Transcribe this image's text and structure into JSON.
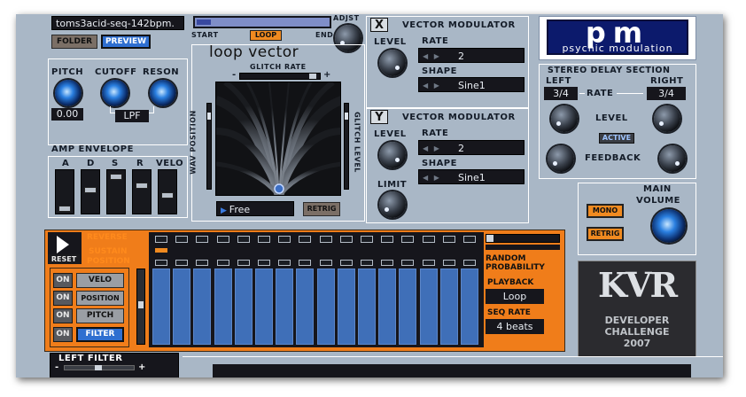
{
  "preset": {
    "name": "toms3acid-seq-142bpm.",
    "folder_label": "FOLDER",
    "preview_label": "PREVIEW"
  },
  "loop": {
    "start_label": "START",
    "loop_label": "LOOP",
    "end_label": "END",
    "adjust_label": "ADJST"
  },
  "filter": {
    "pitch_label": "PITCH",
    "cutoff_label": "CUTOFF",
    "reson_label": "RESON",
    "pitch_value": "0.00",
    "type_value": "LPF"
  },
  "amp_env": {
    "title": "AMP ENVELOPE",
    "labels": [
      "A",
      "D",
      "S",
      "R",
      "VELO"
    ]
  },
  "loop_vector": {
    "title": "loop vector",
    "glitch_rate_label": "GLITCH RATE",
    "minus": "-",
    "plus": "+",
    "wav_position_label": "WAV POSITION",
    "glitch_level_label": "GLITCH LEVEL",
    "mode_value": "Free",
    "retrig_label": "RETRIG"
  },
  "vector_mod_1": {
    "number": "X",
    "title": "VECTOR MODULATOR",
    "level_label": "LEVEL",
    "rate_label": "RATE",
    "rate_value": "2",
    "shape_label": "SHAPE",
    "shape_value": "Sine1"
  },
  "vector_mod_2": {
    "number": "Y",
    "title": "VECTOR MODULATOR",
    "level_label": "LEVEL",
    "rate_label": "RATE",
    "rate_value": "2",
    "shape_label": "SHAPE",
    "shape_value": "Sine1",
    "limit_label": "LIMIT"
  },
  "brand": {
    "logo_text": "pm",
    "subtitle": "psychic modulation"
  },
  "delay": {
    "title": "STEREO DELAY SECTION",
    "left_label": "LEFT",
    "right_label": "RIGHT",
    "left_value": "3/4",
    "right_value": "3/4",
    "rate_label": "RATE",
    "level_label": "LEVEL",
    "active_label": "ACTIVE",
    "feedback_label": "FEEDBACK"
  },
  "main_vol": {
    "title": "MAIN",
    "volume_label": "VOLUME",
    "mono_label": "MONO",
    "retrig_label": "RETRIG"
  },
  "sequencer": {
    "reset_label": "RESET",
    "reverse_label": "REVERSE",
    "sustain_label": "SUSTAIN",
    "position_label": "POSITION",
    "random_prob_label": "RANDOM\nPROBABILITY",
    "playback_label": "PLAYBACK",
    "playback_value": "Loop",
    "seq_rate_label": "SEQ RATE",
    "seq_rate_value": "4 beats",
    "routes": [
      {
        "on": "ON",
        "label": "VELO"
      },
      {
        "on": "ON",
        "label": "POSITION"
      },
      {
        "on": "ON",
        "label": "PITCH"
      },
      {
        "on": "ON",
        "label": "FILTER"
      }
    ],
    "steps": 16
  },
  "kvr": {
    "logo": "KVR",
    "line1": "DEVELOPER",
    "line2": "CHALLENGE",
    "line3": "2007"
  },
  "left_filter": {
    "title": "LEFT FILTER",
    "minus": "-",
    "plus": "+"
  },
  "colors": {
    "panel": "#a9b7c6",
    "accent_orange": "#f07d1a",
    "accent_blue": "#2f6fd0",
    "display_bg": "#16161c"
  }
}
